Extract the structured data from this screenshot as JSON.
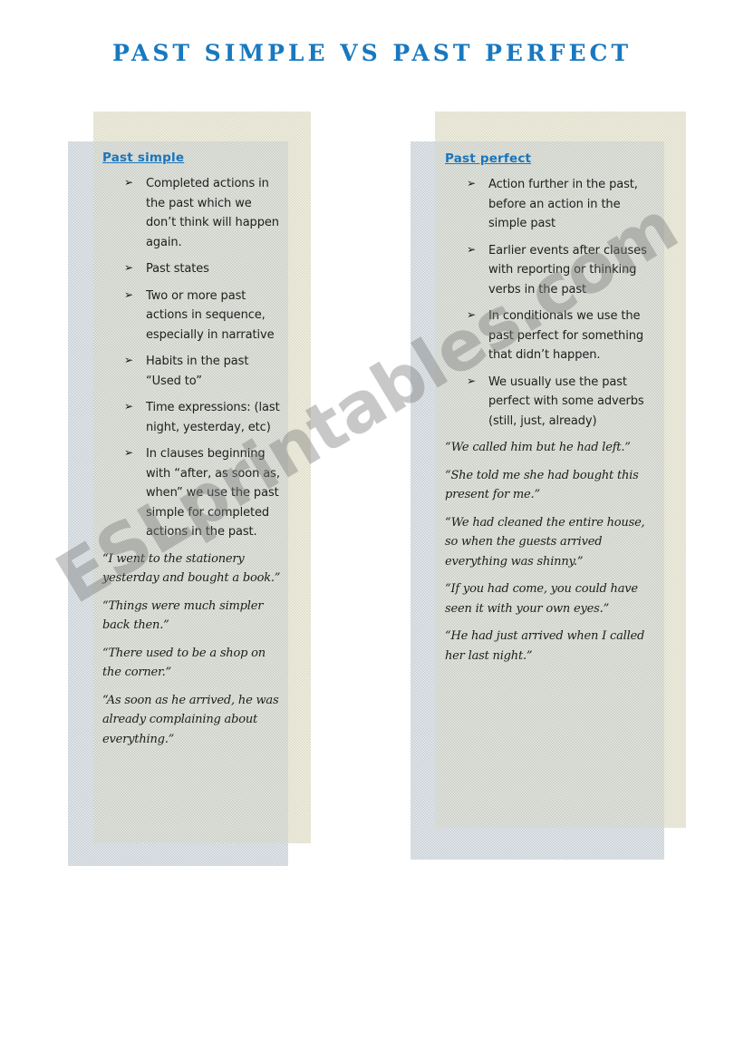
{
  "page": {
    "title": "PAST SIMPLE VS PAST PERFECT",
    "watermark": "ESLprintables.com"
  },
  "columns": [
    {
      "heading": "Past simple",
      "bullet_icon": "➢",
      "rules": [
        "Completed actions in the past which we don’t think will happen again.",
        "Past states",
        "Two or more past actions in sequence, especially in narrative",
        "Habits in the past “Used to”",
        "Time expressions: (last night, yesterday, etc)",
        "In clauses beginning with “after, as soon as, when” we use the past simple for completed actions in the past."
      ],
      "examples": [
        "“I went to the stationery yesterday and bought a book.”",
        "“Things were much simpler back then.”",
        "“There used to be a shop on the corner.”",
        "“As soon as he arrived, he was already complaining about everything.”"
      ]
    },
    {
      "heading": "Past perfect",
      "bullet_icon": "➢",
      "rules": [
        "Action further in the past, before an action in the simple past",
        "Earlier events after clauses with reporting or thinking verbs in the past",
        "In conditionals we use the past perfect for something that didn’t happen.",
        "We usually use the past perfect with some adverbs (still, just, already)"
      ],
      "examples": [
        "“We called him but he had left.”",
        "“She told me she had bought this present for me.”",
        "“We had cleaned the entire house, so when the guests arrived everything was shinny.”",
        "“If you had come, you could have seen it with your own eyes.”",
        "“He had just arrived when I called her last night.”"
      ]
    }
  ],
  "colors": {
    "title_blue": "#1878c0",
    "heading_blue": "#1b75bc",
    "panel_back": "#dedcc6",
    "panel_front": "#c2cbd2"
  }
}
